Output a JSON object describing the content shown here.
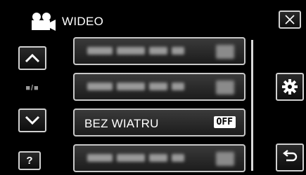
{
  "header": {
    "title": "WIDEO",
    "icon": "video-camera-icon"
  },
  "left_nav": {
    "page_indicator": "■/■"
  },
  "help": {
    "label": "?"
  },
  "menu": {
    "items": [
      {
        "label": "",
        "value": ""
      },
      {
        "label": "",
        "value": ""
      },
      {
        "label": "BEZ WIATRU",
        "value": "OFF"
      },
      {
        "label": "",
        "value": ""
      }
    ]
  },
  "icons": {
    "close": "close-icon",
    "settings": "gear-icon",
    "back": "return-icon",
    "up": "chevron-up-icon",
    "down": "chevron-down-icon"
  },
  "colors": {
    "background": "#000000",
    "border": "#c8c8c8",
    "text": "#ffffff"
  }
}
